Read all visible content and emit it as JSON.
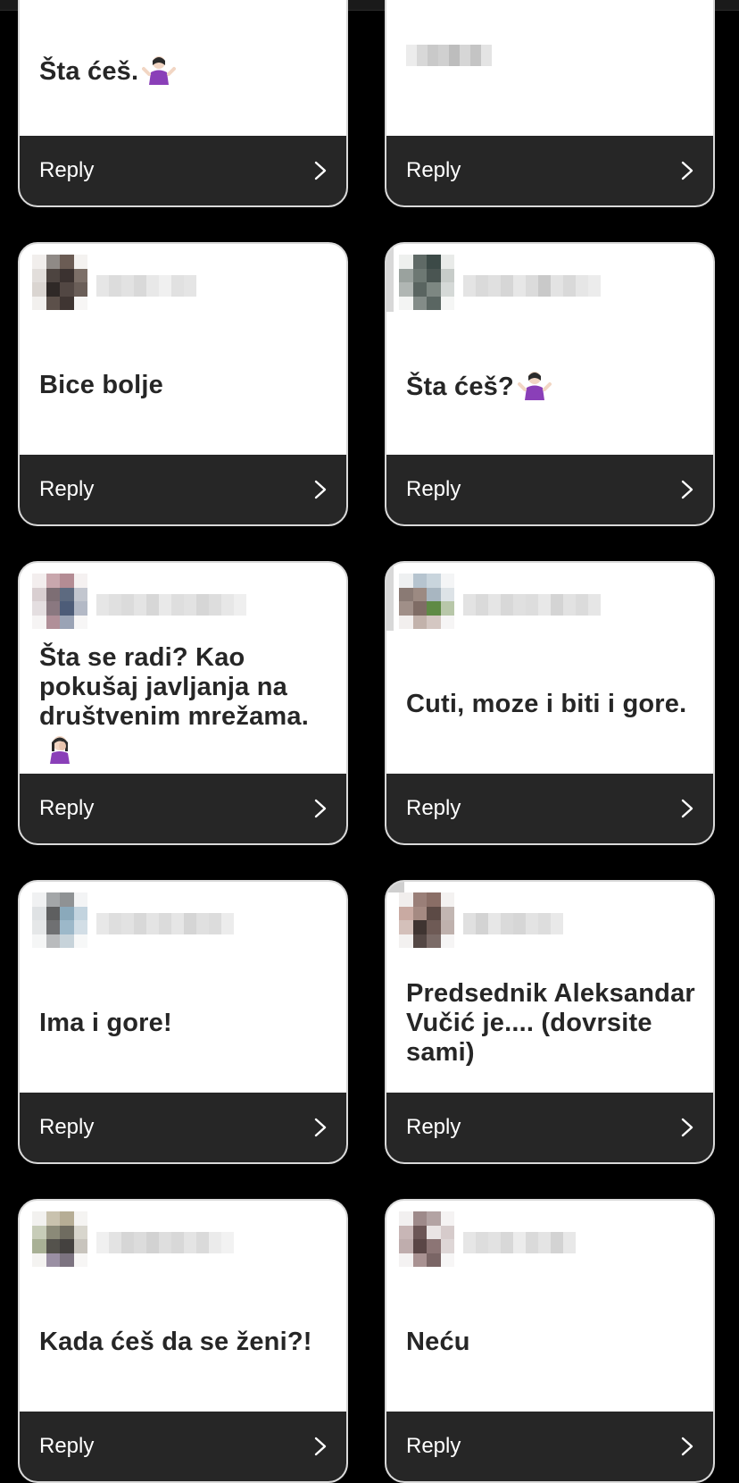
{
  "colors": {
    "background": "#000000",
    "card": "#ffffff",
    "reply_bar": "#262626",
    "text": "#262626",
    "reply_text": "#ffffff"
  },
  "reply_label": "Reply",
  "cards": [
    {
      "text": "Šta ćeš.",
      "emoji": "person-shrugging-emoji"
    },
    {
      "text": ""
    },
    {
      "text": "Bice bolje"
    },
    {
      "text": "Šta ćeš?",
      "emoji": "person-shrugging-emoji"
    },
    {
      "text": "Šta se radi? Kao pokušaj javljanja na društvenim mrežama.",
      "emoji": "person-facepalming-emoji"
    },
    {
      "text": "Cuti, moze i biti i gore."
    },
    {
      "text": "Ima i gore!"
    },
    {
      "text": "Predsednik Aleksandar Vučić je.... (dovrsite sami)"
    },
    {
      "text": "Kada ćeš da se ženi?!"
    },
    {
      "text": "Neću"
    }
  ]
}
